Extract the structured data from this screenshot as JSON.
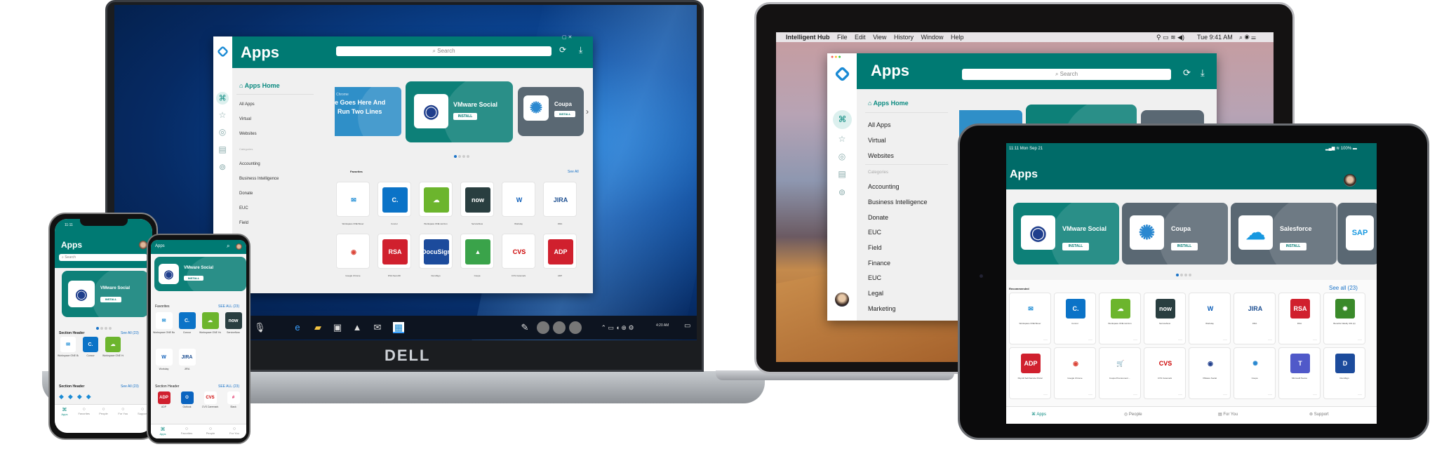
{
  "colors": {
    "brand_teal": "#007a73",
    "ipad_teal": "#006b68",
    "accent_blue": "#1a73c8",
    "gray_card": "#5a6873"
  },
  "windows_laptop": {
    "brand": "DELL",
    "app": {
      "title": "Apps",
      "search_placeholder": "Search",
      "nav_home": "Apps Home",
      "nav_items": [
        "All Apps",
        "Virtual",
        "Websites"
      ],
      "categories_label": "Categories",
      "categories": [
        "Accounting",
        "Business Intelligence",
        "Donate",
        "EUC",
        "Field"
      ],
      "banner": {
        "eyebrow": "Chrome",
        "headline_line1": "e Goes Here And",
        "headline_line2": "Run Two Lines"
      },
      "featured": [
        {
          "name": "VMware Social",
          "button": "INSTALL"
        },
        {
          "name": "Coupa",
          "button": "INSTALL"
        }
      ],
      "favorites_label": "Favorites",
      "see_all": "See All",
      "favorites": [
        {
          "label": "Workspace ONE Boxer",
          "glyph": "✉",
          "bg": "#fff",
          "fg": "#1a8ad4"
        },
        {
          "label": "Concur",
          "glyph": "C.",
          "bg": "#0b73c7",
          "fg": "#fff"
        },
        {
          "label": "Workspace ONE Horizon",
          "glyph": "☁",
          "bg": "#6cb52d",
          "fg": "#fff"
        },
        {
          "label": "ServiceNow",
          "glyph": "now",
          "bg": "#293e40",
          "fg": "#fff"
        },
        {
          "label": "Workday",
          "glyph": "W",
          "bg": "#fff",
          "fg": "#0a5cb8"
        },
        {
          "label": "JIRA",
          "glyph": "JIRA",
          "bg": "#fff",
          "fg": "#1d4f91"
        },
        {
          "label": "Google Chrome",
          "glyph": "◉",
          "bg": "#fff",
          "fg": "#db4437"
        },
        {
          "label": "RSA SecurID",
          "glyph": "RSA",
          "bg": "#d0202e",
          "fg": "#fff"
        },
        {
          "label": "DocuSign",
          "glyph": "DocuSign",
          "bg": "#1c4b9c",
          "fg": "#fff"
        },
        {
          "label": "Coupa",
          "glyph": "▲",
          "bg": "#3aa34a",
          "fg": "#fff"
        },
        {
          "label": "CVS Caremark",
          "glyph": "CVS",
          "bg": "#fff",
          "fg": "#cc0000"
        },
        {
          "label": "ADP",
          "glyph": "ADP",
          "bg": "#d0202e",
          "fg": "#fff"
        }
      ]
    },
    "taskbar_time": "4:20 AM"
  },
  "mac_laptop": {
    "menu_bar": {
      "app": "Intelligent Hub",
      "menus": [
        "File",
        "Edit",
        "View",
        "History",
        "Window",
        "Help"
      ],
      "clock": "Tue 9:41 AM"
    },
    "app": {
      "title": "Apps",
      "search_placeholder": "Search",
      "nav_home": "Apps Home",
      "nav_items": [
        "All Apps",
        "Virtual",
        "Websites"
      ],
      "categories_label": "Categories",
      "categories": [
        "Accounting",
        "Business Intelligence",
        "Donate",
        "EUC",
        "Field",
        "Finance",
        "EUC",
        "Legal",
        "Marketing"
      ]
    }
  },
  "ipad": {
    "status_time": "11:11  Mon Sep 21",
    "battery": "100%",
    "title": "Apps",
    "featured": [
      {
        "name": "VMware Social",
        "button": "INSTALL",
        "glyph": "◉",
        "fg": "#1f3e8c",
        "bg": "#0d8078"
      },
      {
        "name": "Coupa",
        "button": "INSTALL",
        "glyph": "✺",
        "fg": "#2a88d0",
        "bg": "#5a6873"
      },
      {
        "name": "Salesforce",
        "button": "INSTALL",
        "glyph": "☁",
        "fg": "#1798e0",
        "bg": "#5a6873"
      }
    ],
    "recommended_label": "Recommended",
    "see_all": "See all (23)",
    "apps": [
      {
        "label": "Workspace ONE Boxer",
        "glyph": "✉",
        "bg": "#fff",
        "fg": "#1a8ad4"
      },
      {
        "label": "Concur",
        "glyph": "C.",
        "bg": "#0b73c7",
        "fg": "#fff"
      },
      {
        "label": "Workspace ONE Horizon",
        "glyph": "☁",
        "bg": "#6cb52d",
        "fg": "#fff"
      },
      {
        "label": "ServiceNow",
        "glyph": "now",
        "bg": "#293e40",
        "fg": "#fff"
      },
      {
        "label": "Workday",
        "glyph": "W",
        "bg": "#fff",
        "fg": "#0a5cb8"
      },
      {
        "label": "JIRA",
        "glyph": "JIRA",
        "bg": "#fff",
        "fg": "#1d4f91"
      },
      {
        "label": "RSA",
        "glyph": "RSA",
        "bg": "#d0202e",
        "fg": "#fff"
      },
      {
        "label": "Benefits Fidelity 401 (k)",
        "glyph": "✹",
        "bg": "#3a8a2a",
        "fg": "#fff"
      },
      {
        "label": "Payroll Self-Service Portal",
        "glyph": "ADP",
        "bg": "#d0202e",
        "fg": "#fff"
      },
      {
        "label": "Google Chrome",
        "glyph": "◉",
        "bg": "#fff",
        "fg": "#db4437"
      },
      {
        "label": "Coupa Procurement ...",
        "glyph": "🛒",
        "bg": "#fff",
        "fg": "#1a8ad4"
      },
      {
        "label": "CVS Caremark",
        "glyph": "CVS",
        "bg": "#fff",
        "fg": "#cc0000"
      },
      {
        "label": "VMware Social",
        "glyph": "◉",
        "bg": "#fff",
        "fg": "#1f3e8c"
      },
      {
        "label": "Coupa",
        "glyph": "✺",
        "bg": "#fff",
        "fg": "#2a88d0"
      },
      {
        "label": "Microsoft Teams",
        "glyph": "T",
        "bg": "#5059c9",
        "fg": "#fff"
      },
      {
        "label": "DocuSign",
        "glyph": "D",
        "bg": "#1c4b9c",
        "fg": "#fff"
      }
    ],
    "tabs": [
      {
        "label": "Apps",
        "icon": "apps-icon"
      },
      {
        "label": "People",
        "icon": "people-icon"
      },
      {
        "label": "For You",
        "icon": "for-you-icon"
      },
      {
        "label": "Support",
        "icon": "support-icon"
      }
    ]
  },
  "iphone": {
    "status_time": "11:11",
    "title": "Apps",
    "search_placeholder": "Search",
    "featured": {
      "name": "VMware Social",
      "button": "INSTALL"
    },
    "section1": {
      "label": "Section Header",
      "see_all": "See All (23)"
    },
    "section1_apps": [
      {
        "label": "Workspace ONE Boxer",
        "glyph": "✉",
        "bg": "#fff",
        "fg": "#1a8ad4"
      },
      {
        "label": "Concur",
        "glyph": "C.",
        "bg": "#0b73c7",
        "fg": "#fff"
      },
      {
        "label": "Workspace ONE Horizon",
        "glyph": "☁",
        "bg": "#6cb52d",
        "fg": "#fff"
      }
    ],
    "section2": {
      "label": "Section Header",
      "see_all": "See All (23)"
    },
    "tabs": [
      "Apps",
      "Favorites",
      "People",
      "For You",
      "Support"
    ]
  },
  "android": {
    "title": "Apps",
    "featured": {
      "name": "VMware Social",
      "button": "INSTALL"
    },
    "favorites": {
      "label": "Favorites",
      "see_all": "SEE ALL (23)"
    },
    "favorite_apps": [
      {
        "label": "Workspace ONE Boxer",
        "glyph": "✉",
        "bg": "#fff",
        "fg": "#1a8ad4"
      },
      {
        "label": "Concur",
        "glyph": "C.",
        "bg": "#0b73c7",
        "fg": "#fff"
      },
      {
        "label": "Workspace ONE Horizon",
        "glyph": "☁",
        "bg": "#6cb52d",
        "fg": "#fff"
      },
      {
        "label": "ServiceNow",
        "glyph": "now",
        "bg": "#293e40",
        "fg": "#fff"
      },
      {
        "label": "Workday",
        "glyph": "W",
        "bg": "#fff",
        "fg": "#0a5cb8"
      },
      {
        "label": "JIRA",
        "glyph": "JIRA",
        "bg": "#fff",
        "fg": "#1d4f91"
      }
    ],
    "section": {
      "label": "Section Header",
      "see_all": "SEE ALL (23)"
    },
    "section_apps": [
      {
        "label": "ADP",
        "glyph": "ADP",
        "bg": "#d0202e",
        "fg": "#fff"
      },
      {
        "label": "Outlook",
        "glyph": "O",
        "bg": "#0a64c0",
        "fg": "#fff"
      },
      {
        "label": "CVS Caremark",
        "glyph": "CVS",
        "bg": "#fff",
        "fg": "#cc0000"
      },
      {
        "label": "Slack",
        "glyph": "#",
        "bg": "#fff",
        "fg": "#e01e5a"
      }
    ],
    "tabs": [
      "Apps",
      "Favorites",
      "People",
      "For You"
    ]
  }
}
